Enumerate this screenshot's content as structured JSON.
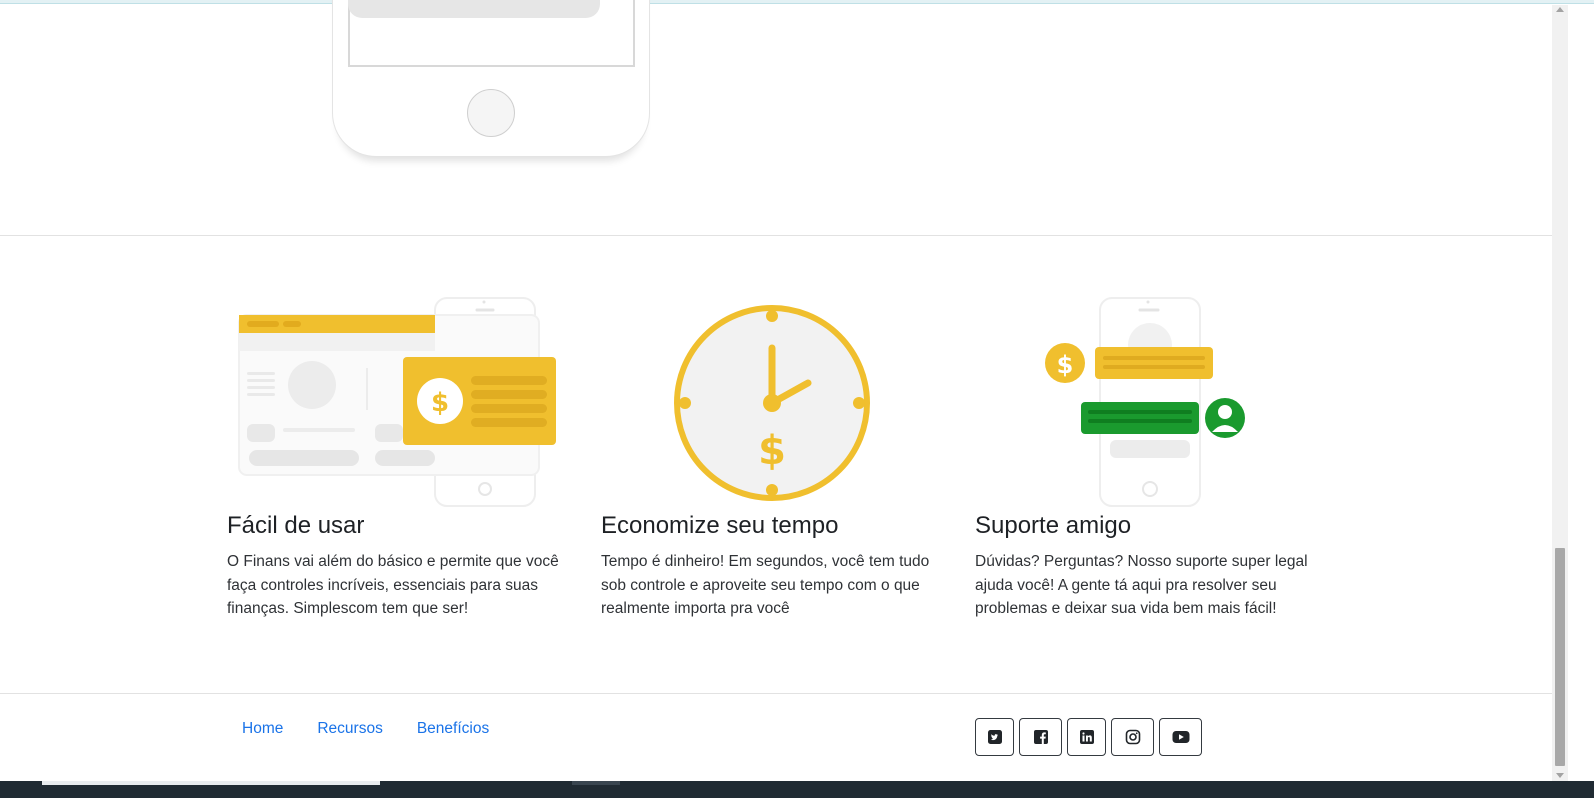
{
  "features": [
    {
      "title": "Fácil de usar",
      "text": "O Finans vai além do básico e permite que você faça controles incríveis, essenciais para suas finanças. Simplescom tem que ser!",
      "illustration": "dashboard-payment-card-illustration"
    },
    {
      "title": "Economize seu tempo",
      "text": "Tempo é dinheiro! Em segundos, você tem tudo sob controle e aproveite seu tempo com o que realmente importa pra você",
      "illustration": "clock-dollar-illustration"
    },
    {
      "title": "Suporte amigo",
      "text": "Dúvidas? Perguntas? Nosso suporte super legal ajuda você! A gente tá aqui pra resolver seu problemas e deixar sua vida bem mais fácil!",
      "illustration": "phone-chat-support-illustration"
    }
  ],
  "footer": {
    "nav": [
      "Home",
      "Recursos",
      "Benefícios"
    ],
    "social": [
      "twitter-icon",
      "facebook-icon",
      "linkedin-icon",
      "instagram-icon",
      "youtube-icon"
    ]
  },
  "colors": {
    "accent_yellow": "#f0bf2e",
    "accent_green": "#1a9a2e",
    "link_blue": "#1a73e8",
    "illustration_gray": "#ececec"
  }
}
